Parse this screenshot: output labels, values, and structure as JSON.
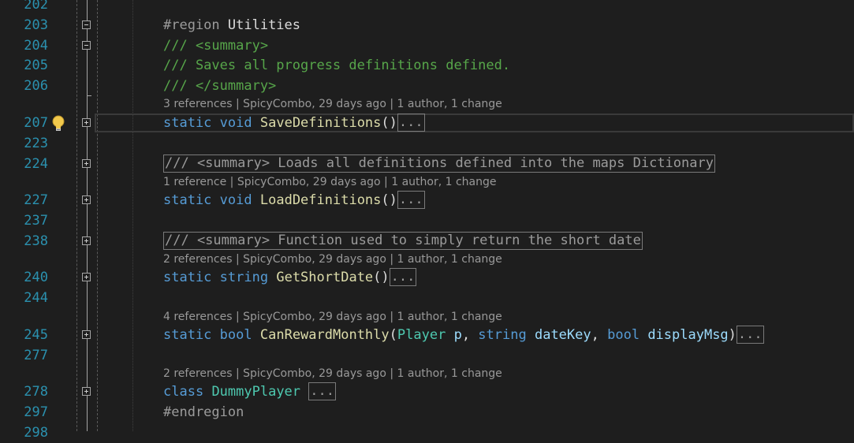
{
  "lines": {
    "l202": {
      "num": "202"
    },
    "l203": {
      "num": "203",
      "k1": "#region",
      "k2": " Utilities"
    },
    "l204": {
      "num": "204",
      "text": "/// <summary>"
    },
    "l205": {
      "num": "205",
      "text": "/// Saves all progress definitions defined."
    },
    "l206": {
      "num": "206",
      "text": "/// </summary>"
    },
    "lens1": "3 references | SpicyCombo, 29 days ago | 1 author, 1 change",
    "l207": {
      "num": "207",
      "kw1": "static",
      "kw2": "void",
      "fn": "SaveDefinitions",
      "paren": "()",
      "ellipsis": "..."
    },
    "l223": {
      "num": "223"
    },
    "l224": {
      "num": "224",
      "comment": "/// <summary> Loads all definitions defined into the maps Dictionary"
    },
    "lens2": "1 reference | SpicyCombo, 29 days ago | 1 author, 1 change",
    "l227": {
      "num": "227",
      "kw1": "static",
      "kw2": "void",
      "fn": "LoadDefinitions",
      "paren": "()",
      "ellipsis": "..."
    },
    "l237": {
      "num": "237"
    },
    "l238": {
      "num": "238",
      "comment": "/// <summary> Function used to simply return the short date"
    },
    "lens3": "2 references | SpicyCombo, 29 days ago | 1 author, 1 change",
    "l240": {
      "num": "240",
      "kw1": "static",
      "kw2": "string",
      "fn": "GetShortDate",
      "paren": "()",
      "ellipsis": "..."
    },
    "l244": {
      "num": "244"
    },
    "lens4": "4 references | SpicyCombo, 29 days ago | 1 author, 1 change",
    "l245": {
      "num": "245",
      "kw1": "static",
      "kw2": "bool",
      "fn": "CanRewardMonthly",
      "open": "(",
      "t1": "Player",
      "p1": "p",
      "t2": "string",
      "p2": "dateKey",
      "t3": "bool",
      "p3": "displayMsg",
      "close": ")",
      "ellipsis": "..."
    },
    "l277": {
      "num": "277"
    },
    "lens5": "2 references | SpicyCombo, 29 days ago | 1 author, 1 change",
    "l278": {
      "num": "278",
      "kw1": "class",
      "cls": "DummyPlayer",
      "ellipsis": "..."
    },
    "l297": {
      "num": "297",
      "text": "#endregion"
    },
    "l298": {
      "num": "298"
    }
  },
  "colors": {
    "background": "#1e1e1e",
    "line_number": "#2b91af",
    "keyword": "#569cd6",
    "function": "#dcdcaa",
    "class": "#4ec9b0",
    "parameter": "#9cdcfe",
    "comment": "#57a64a"
  },
  "icons": {
    "quick_action": "lightbulb-icon",
    "fold": "outline-toggle-icon"
  }
}
